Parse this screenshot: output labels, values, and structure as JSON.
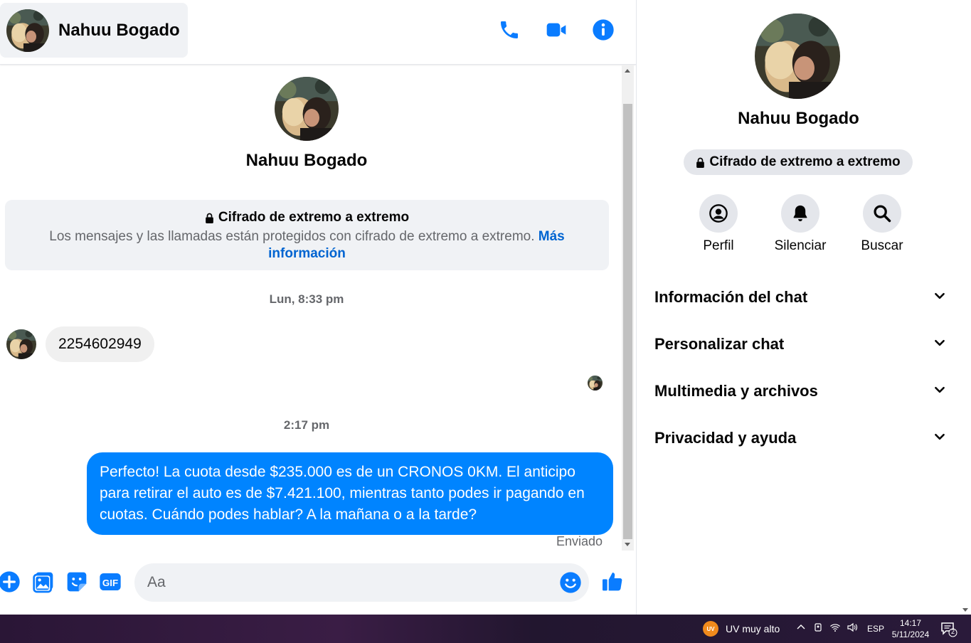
{
  "contact": {
    "name": "Nahuu Bogado"
  },
  "header": {
    "call_icon": "phone-icon",
    "video_icon": "video-camera-icon",
    "info_icon": "info-icon"
  },
  "encryption_notice": {
    "title": "Cifrado de extremo a extremo",
    "text": "Los mensajes y las llamadas están protegidos con cifrado de extremo a extremo.",
    "link": "Más información"
  },
  "messages": [
    {
      "timestamp": "Lun, 8:33 pm",
      "direction": "incoming",
      "text": "2254602949"
    },
    {
      "timestamp": "2:17 pm",
      "direction": "outgoing",
      "text": "Perfecto! La cuota desde $235.000 es de un CRONOS 0KM. El anticipo para retirar el auto es de $7.421.100, mientras tanto podes ir pagando en cuotas. Cuándo podes hablar? A la mañana o a la tarde?",
      "status": "Enviado"
    }
  ],
  "composer": {
    "placeholder": "Aa"
  },
  "info_panel": {
    "encryption_pill": "Cifrado de extremo a extremo",
    "actions": [
      {
        "label": "Perfil",
        "icon": "profile-icon"
      },
      {
        "label": "Silenciar",
        "icon": "bell-icon"
      },
      {
        "label": "Buscar",
        "icon": "search-icon"
      }
    ],
    "sections": [
      {
        "label": "Información del chat"
      },
      {
        "label": "Personalizar chat"
      },
      {
        "label": "Multimedia y archivos"
      },
      {
        "label": "Privacidad y ayuda"
      }
    ]
  },
  "taskbar": {
    "uv_badge": "UV",
    "uv_text": "UV muy alto",
    "language": "ESP",
    "time": "14:17",
    "date": "5/11/2024",
    "notification_count": "2"
  },
  "colors": {
    "accent": "#0084ff",
    "icon_blue": "#0a7cff"
  }
}
